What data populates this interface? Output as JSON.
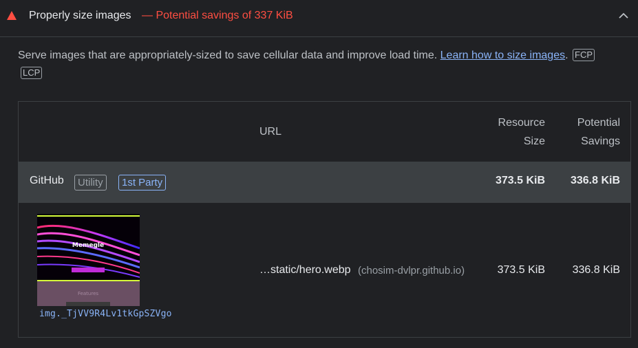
{
  "audit": {
    "title": "Properly size images",
    "savings": "— Potential savings of 337 KiB",
    "status_color": "#ff4e42"
  },
  "description": {
    "text": "Serve images that are appropriately-sized to save cellular data and improve load time. ",
    "link": "Learn how to size images",
    "period": ".",
    "metrics": [
      "FCP",
      "LCP"
    ]
  },
  "table": {
    "headers": {
      "url": "URL",
      "size_line1": "Resource",
      "size_line2": "Size",
      "savings_line1": "Potential",
      "savings_line2": "Savings"
    },
    "group": {
      "entity": "GitHub",
      "tags": [
        "Utility",
        "1st Party"
      ],
      "size": "373.5 KiB",
      "savings": "336.8 KiB"
    },
    "item": {
      "thumbnail_caption": "img._TjVV9R4Lv1tkGpSZVgo",
      "thumbnail_title": "Memegle",
      "thumbnail_footer": "Features",
      "url": "…static/hero.webp",
      "origin": "(chosim-dvlpr.github.io)",
      "size": "373.5 KiB",
      "savings": "336.8 KiB"
    }
  }
}
